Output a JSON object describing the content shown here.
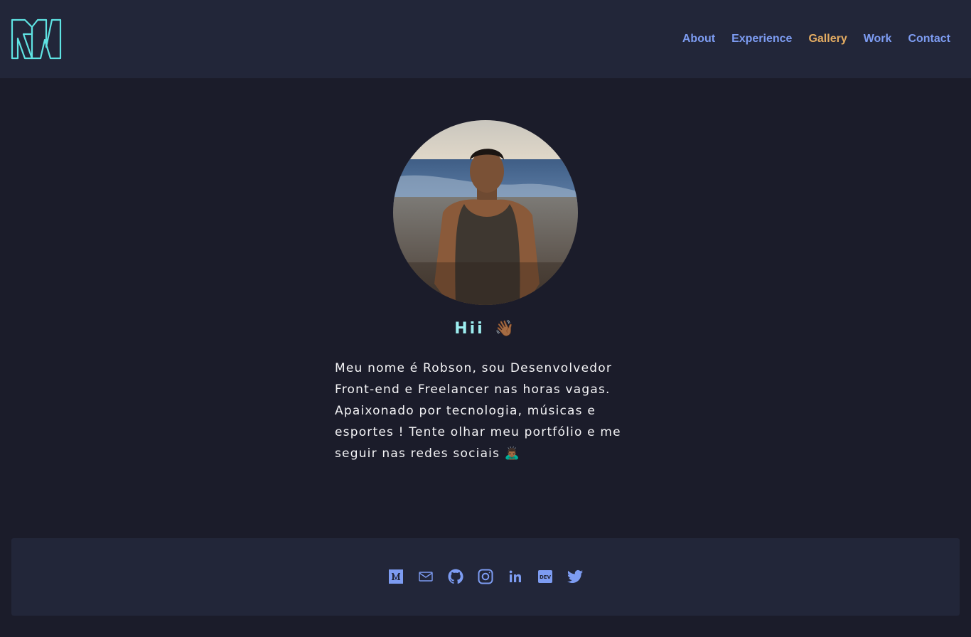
{
  "nav": {
    "items": [
      {
        "label": "About",
        "active": false
      },
      {
        "label": "Experience",
        "active": false
      },
      {
        "label": "Gallery",
        "active": true
      },
      {
        "label": "Work",
        "active": false
      },
      {
        "label": "Contact",
        "active": false
      }
    ]
  },
  "hero": {
    "greeting": "Hii",
    "greeting_emoji": "👋🏾",
    "bio": "Meu nome é Robson, sou Desenvolvedor\nFront-end e Freelancer nas horas vagas.\nApaixonado por tecnologia,  músicas e\nesportes ! Tente olhar meu portfólio e me\nseguir nas redes sociais 🙇🏾‍♂️"
  },
  "footer": {
    "social_icons": [
      "medium-icon",
      "mail-icon",
      "github-icon",
      "instagram-icon",
      "linkedin-icon",
      "dev-icon",
      "twitter-icon"
    ]
  },
  "colors": {
    "background": "#1b1c2a",
    "header": "#222639",
    "nav_link": "#7d9cf2",
    "nav_active": "#e4ac62",
    "logo": "#5fe3e3",
    "greeting": "#9deef0",
    "text": "#f4f4f6"
  }
}
